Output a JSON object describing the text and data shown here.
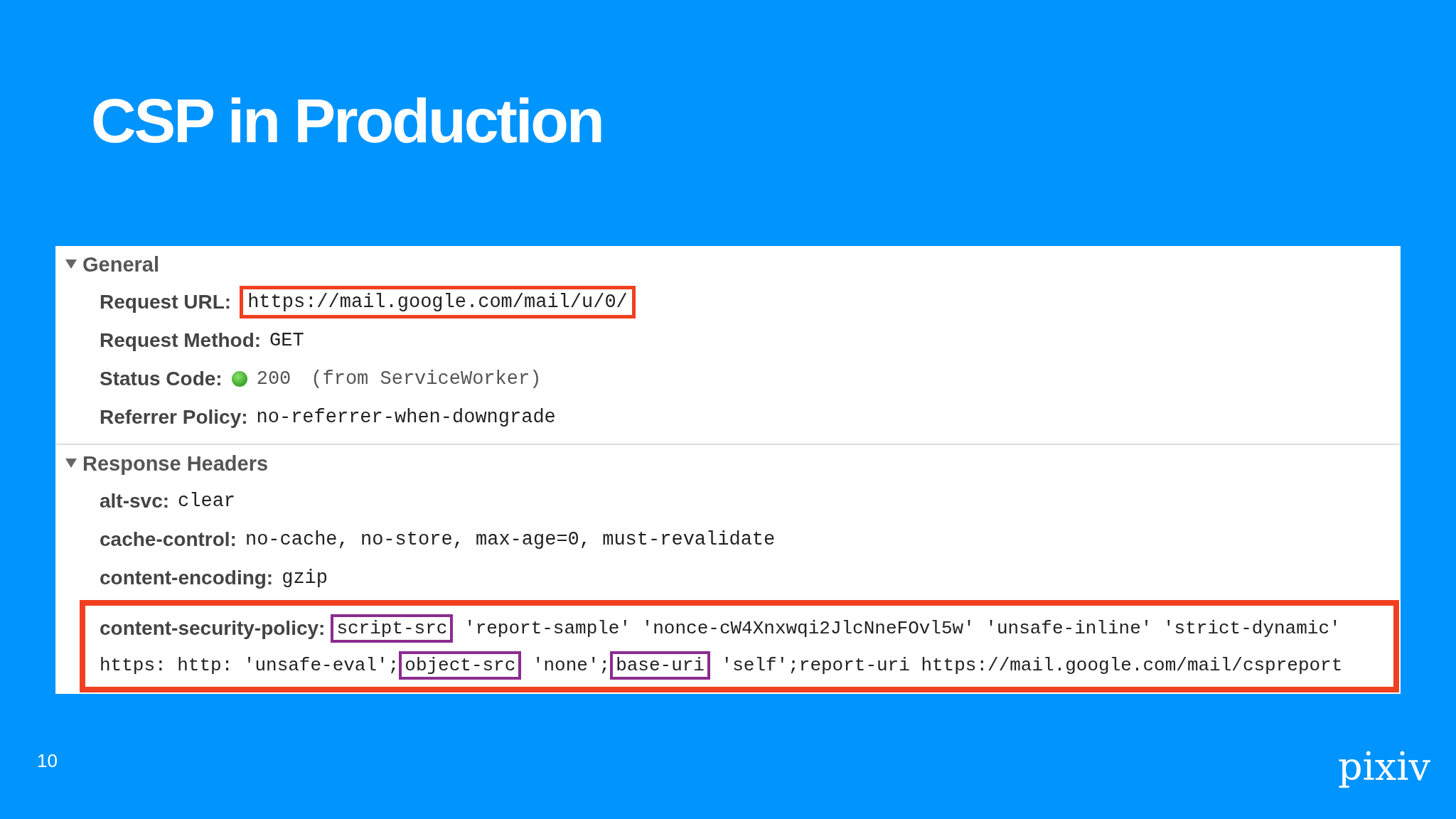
{
  "slide": {
    "title": "CSP in Production",
    "page_number": "10",
    "logo": "pixiv"
  },
  "sections": [
    {
      "title": "General",
      "expanded": true,
      "rows": [
        {
          "kind": "plain",
          "label": "Request URL:",
          "value": "https://mail.google.com/mail/u/0/",
          "highlighted": true
        },
        {
          "kind": "plain",
          "label": "Request Method:",
          "value": "GET",
          "highlighted": false
        },
        {
          "kind": "status",
          "label": "Status Code:",
          "value": "200",
          "note": "(from ServiceWorker)",
          "highlighted": false
        },
        {
          "kind": "plain",
          "label": "Referrer Policy:",
          "value": "no-referrer-when-downgrade",
          "highlighted": false
        }
      ]
    },
    {
      "title": "Response Headers",
      "expanded": true,
      "rows": [
        {
          "kind": "plain",
          "label": "alt-svc:",
          "value": "clear",
          "highlighted": false
        },
        {
          "kind": "plain",
          "label": "cache-control:",
          "value": "no-cache, no-store, max-age=0, must-revalidate",
          "highlighted": false
        },
        {
          "kind": "plain",
          "label": "content-encoding:",
          "value": "gzip",
          "highlighted": false
        },
        {
          "kind": "policy",
          "label": "content-security-policy:",
          "highlighted": true,
          "lines": [
            [
              {
                "text": "script-src",
                "boxed": true
              },
              {
                "text": " 'report-sample' 'nonce-cW4Xnxwqi2JlcNneFOvl5w' 'unsafe-inline' 'strict-dynamic'",
                "boxed": false
              }
            ],
            [
              {
                "text": "https: http: 'unsafe-eval';",
                "boxed": false
              },
              {
                "text": "object-src",
                "boxed": true
              },
              {
                "text": " 'none';",
                "boxed": false
              },
              {
                "text": "base-uri",
                "boxed": true
              },
              {
                "text": " 'self';report-uri https://mail.google.com/mail/cspreport",
                "boxed": false
              }
            ]
          ]
        }
      ]
    }
  ]
}
